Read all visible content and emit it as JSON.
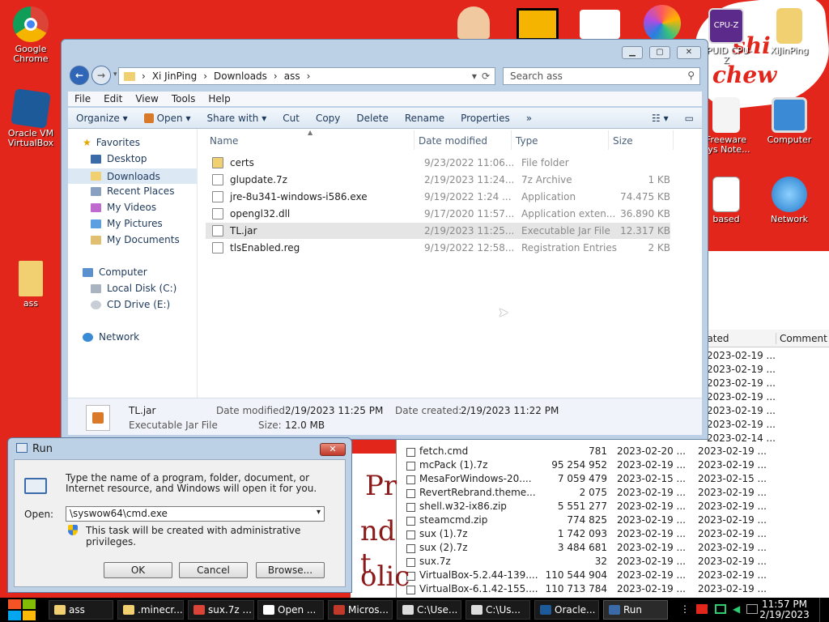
{
  "desktop": {
    "icons_left": [
      {
        "label": "Google Chrome"
      },
      {
        "label": "Oracle VM VirtualBox"
      },
      {
        "label": "ass"
      }
    ],
    "icons_right": [
      {
        "label": "CPUID CPU-Z"
      },
      {
        "label": "XiJinPing"
      },
      {
        "label": "Freeware Sys Note..."
      },
      {
        "label": "Computer"
      },
      {
        "label": "based"
      },
      {
        "label": "Network"
      }
    ],
    "wallpaper_text": [
      "shi",
      "chew"
    ],
    "background_text": [
      "Pr",
      "nd t",
      "olic"
    ]
  },
  "explorer": {
    "breadcrumb": [
      "Xi JinPing",
      "Downloads",
      "ass"
    ],
    "search_placeholder": "Search ass",
    "menu": [
      "File",
      "Edit",
      "View",
      "Tools",
      "Help"
    ],
    "toolbar": [
      "Organize ▾",
      "Open ▾",
      "Share with ▾",
      "Cut",
      "Copy",
      "Delete",
      "Rename",
      "Properties",
      "»"
    ],
    "nav": {
      "favorites": "Favorites",
      "fav_items": [
        "Desktop",
        "Downloads",
        "Recent Places",
        "My Videos",
        "My Pictures",
        "My Documents"
      ],
      "computer": "Computer",
      "computer_items": [
        "Local Disk (C:)",
        "CD Drive (E:)"
      ],
      "network": "Network"
    },
    "columns": [
      "Name",
      "Date modified",
      "Type",
      "Size"
    ],
    "files": [
      {
        "name": "certs",
        "date": "9/23/2022 11:06...",
        "type": "File folder",
        "size": ""
      },
      {
        "name": "glupdate.7z",
        "date": "2/19/2023 11:24...",
        "type": "7z Archive",
        "size": "1 KB"
      },
      {
        "name": "jre-8u341-windows-i586.exe",
        "date": "9/19/2022 1:24 ...",
        "type": "Application",
        "size": "74.475 KB"
      },
      {
        "name": "opengl32.dll",
        "date": "9/17/2020 11:57...",
        "type": "Application exten...",
        "size": "36.890 KB"
      },
      {
        "name": "TL.jar",
        "date": "2/19/2023 11:25...",
        "type": "Executable Jar File",
        "size": "12.317 KB"
      },
      {
        "name": "tlsEnabled.reg",
        "date": "9/19/2022 12:58...",
        "type": "Registration Entries",
        "size": "2 KB"
      }
    ],
    "details": {
      "name": "TL.jar",
      "kind": "Executable Jar File",
      "modified_label": "Date modified:",
      "modified": "2/19/2023 11:25 PM",
      "created_label": "Date created:",
      "created": "2/19/2023 11:22 PM",
      "size_label": "Size:",
      "size": "12.0 MB"
    }
  },
  "run": {
    "title": "Run",
    "description": "Type the name of a program, folder, document, or Internet resource, and Windows will open it for you.",
    "open_label": "Open:",
    "open_value": "\\syswow64\\cmd.exe",
    "admin_note": "This task will be created with administrative privileges.",
    "ok": "OK",
    "cancel": "Cancel",
    "browse": "Browse..."
  },
  "bglist": {
    "columns": [
      "eated",
      "Comment"
    ],
    "created_only": [
      "2023-02-19 ...",
      "2023-02-19 ...",
      "2023-02-19 ...",
      "2023-02-19 ...",
      "2023-02-19 ...",
      "2023-02-19 ...",
      "2023-02-14 ..."
    ],
    "rows": [
      {
        "name": "fetch.cmd",
        "size": "781",
        "mod": "2023-02-20 ...",
        "created": "2023-02-19 ..."
      },
      {
        "name": "mcPack (1).7z",
        "size": "95 254 952",
        "mod": "2023-02-19 ...",
        "created": "2023-02-19 ..."
      },
      {
        "name": "MesaForWindows-20....",
        "size": "7 059 479",
        "mod": "2023-02-15 ...",
        "created": "2023-02-15 ..."
      },
      {
        "name": "RevertRebrand.theme...",
        "size": "2 075",
        "mod": "2023-02-19 ...",
        "created": "2023-02-19 ..."
      },
      {
        "name": "shell.w32-ix86.zip",
        "size": "5 551 277",
        "mod": "2023-02-19 ...",
        "created": "2023-02-19 ..."
      },
      {
        "name": "steamcmd.zip",
        "size": "774 825",
        "mod": "2023-02-19 ...",
        "created": "2023-02-19 ..."
      },
      {
        "name": "sux (1).7z",
        "size": "1 742 093",
        "mod": "2023-02-19 ...",
        "created": "2023-02-19 ..."
      },
      {
        "name": "sux (2).7z",
        "size": "3 484 681",
        "mod": "2023-02-19 ...",
        "created": "2023-02-19 ..."
      },
      {
        "name": "sux.7z",
        "size": "32",
        "mod": "2023-02-19 ...",
        "created": "2023-02-19 ..."
      },
      {
        "name": "VirtualBox-5.2.44-139....",
        "size": "110 544 904",
        "mod": "2023-02-19 ...",
        "created": "2023-02-19 ..."
      },
      {
        "name": "VirtualBox-6.1.42-155....",
        "size": "110 713 784",
        "mod": "2023-02-19 ...",
        "created": "2023-02-19 ..."
      }
    ]
  },
  "taskbar": {
    "tasks": [
      "ass",
      ".minecr...",
      "sux.7z ...",
      "Open ...",
      "Micros...",
      "C:\\Use...",
      "C:\\Us...",
      "Oracle...",
      "Run"
    ],
    "time": "11:57 PM",
    "date": "2/19/2023"
  },
  "colors": {
    "desktop": "#e2261c",
    "window_frame": "#bcd0e6",
    "selection": "#e5e5e5"
  }
}
